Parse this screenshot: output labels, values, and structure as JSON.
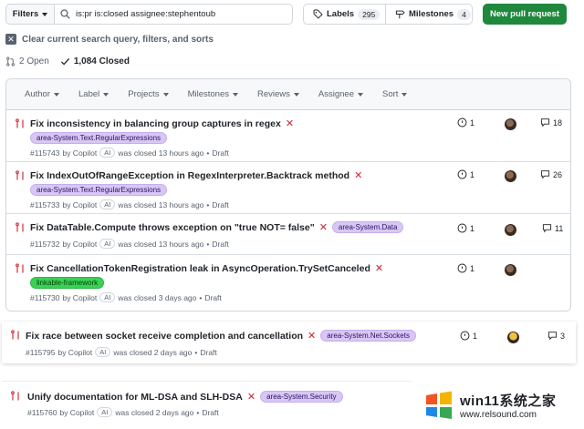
{
  "toolbar": {
    "filters_label": "Filters",
    "search_value": "is:pr is:closed assignee:stephentoub",
    "labels_label": "Labels",
    "labels_count": "295",
    "milestones_label": "Milestones",
    "milestones_count": "4",
    "new_pr_label": "New pull request"
  },
  "clear_text": "Clear current search query, filters, and sorts",
  "state": {
    "open": "2 Open",
    "closed": "1,084 Closed"
  },
  "filter_menus": [
    "Author",
    "Label",
    "Projects",
    "Milestones",
    "Reviews",
    "Assignee",
    "Sort"
  ],
  "prs": [
    {
      "title": "Fix inconsistency in balancing group captures in regex",
      "label": "area-System.Text.RegularExpressions",
      "number": "#115743",
      "by": "by Copilot",
      "ai": "AI",
      "closed": "was closed 13 hours ago",
      "draft": "Draft",
      "checks": "1",
      "comments": "18"
    },
    {
      "title": "Fix IndexOutOfRangeException in RegexInterpreter.Backtrack method",
      "label": "area-System.Text.RegularExpressions",
      "number": "#115733",
      "by": "by Copilot",
      "ai": "AI",
      "closed": "was closed 13 hours ago",
      "draft": "Draft",
      "checks": "1",
      "comments": "26"
    },
    {
      "title": "Fix DataTable.Compute throws exception on \"true NOT= false\"",
      "label": "area-System.Data",
      "number": "#115732",
      "by": "by Copilot",
      "ai": "AI",
      "closed": "was closed 13 hours ago",
      "draft": "Draft",
      "checks": "1",
      "comments": "11"
    },
    {
      "title": "Fix CancellationTokenRegistration leak in AsyncOperation.TrySetCanceled",
      "label": "linkable-framework",
      "number": "#115730",
      "by": "by Copilot",
      "ai": "AI",
      "closed": "was closed 3 days ago",
      "draft": "Draft",
      "checks": "1",
      "comments": ""
    },
    {
      "title": "Fix race between socket receive completion and cancellation",
      "label": "area-System.Net.Sockets",
      "number": "#115795",
      "by": "by Copilot",
      "ai": "AI",
      "closed": "was closed 2 days ago",
      "draft": "Draft",
      "checks": "1",
      "comments": "3"
    },
    {
      "title": "Unify documentation for ML-DSA and SLH-DSA",
      "label": "area-System.Security",
      "number": "#115760",
      "by": "by Copilot",
      "ai": "AI",
      "closed": "was closed 2 days ago",
      "draft": "Draft",
      "checks": "",
      "comments": ""
    }
  ],
  "watermark": {
    "title": "win11系统之家",
    "url": "www.relsound.com"
  },
  "colors": {
    "accent_green": "#1f883d",
    "closed_red": "#cf222e",
    "label_purple": "#d8c7f5",
    "label_green": "#39d353"
  }
}
